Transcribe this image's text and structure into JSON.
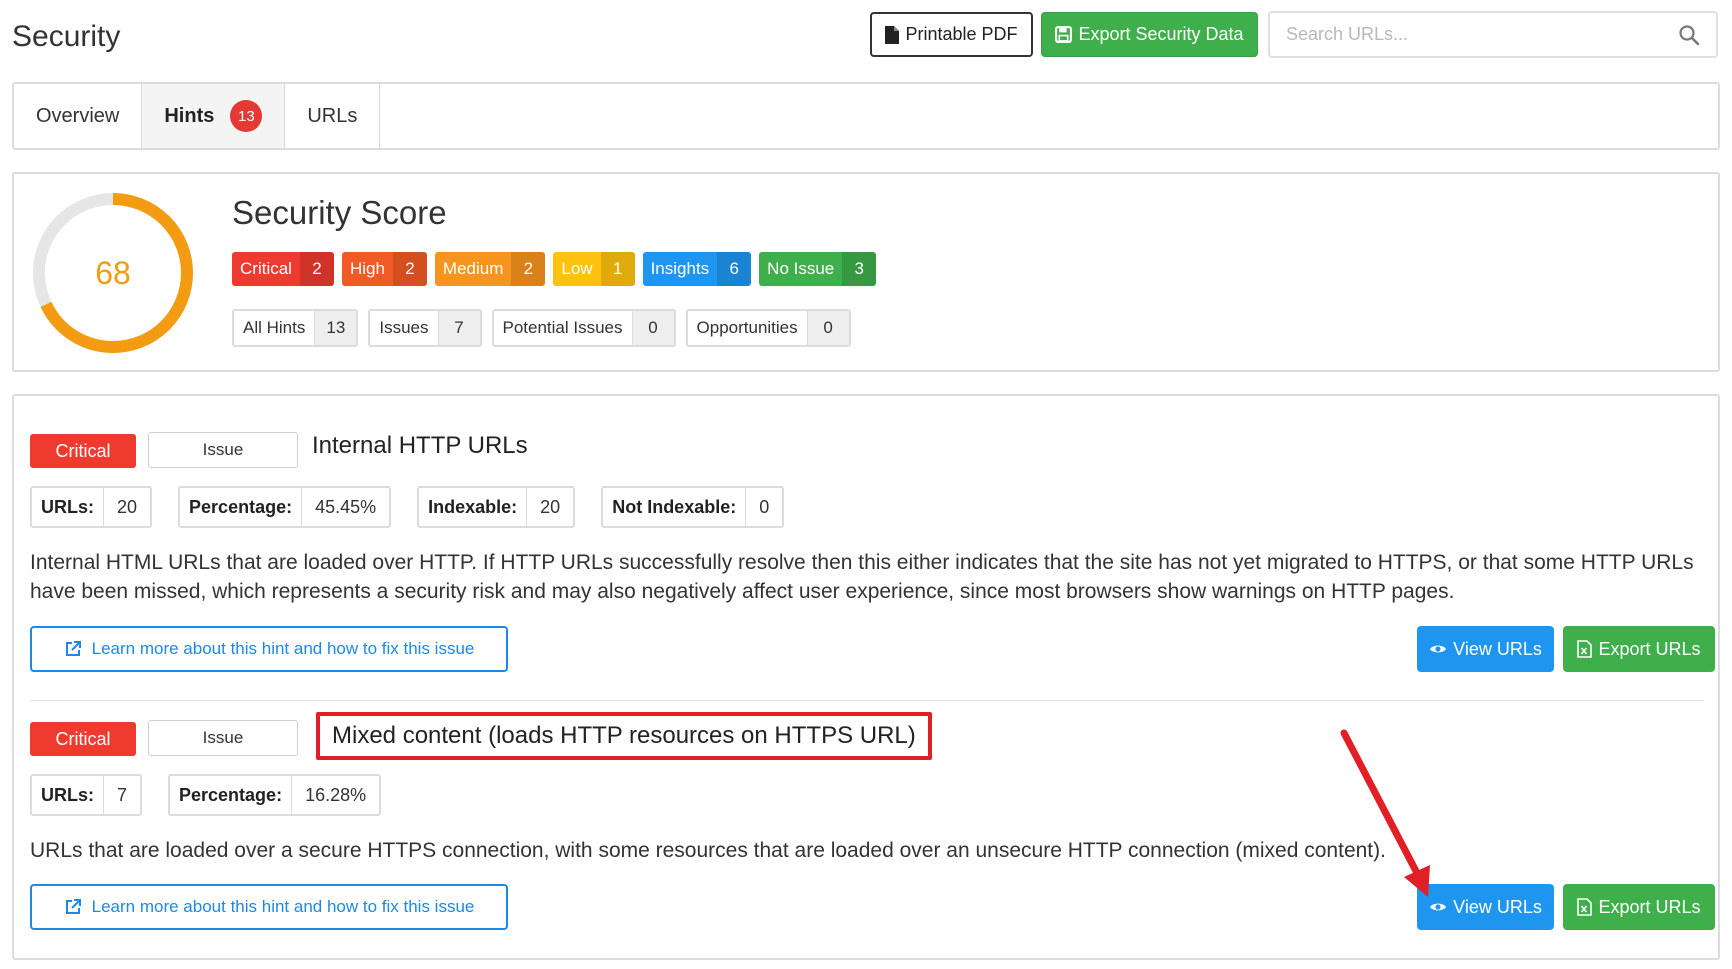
{
  "header": {
    "title": "Security",
    "printable_pdf_label": "Printable PDF",
    "export_data_label": "Export Security Data",
    "search_placeholder": "Search URLs..."
  },
  "tabs": [
    {
      "label": "Overview",
      "active": false
    },
    {
      "label": "Hints",
      "active": true,
      "badge": "13"
    },
    {
      "label": "URLs",
      "active": false
    }
  ],
  "score": {
    "value": "68",
    "fraction": 0.68,
    "heading": "Security Score",
    "color": "#f39c12",
    "track_color": "#e6e6e6"
  },
  "severities": [
    {
      "label": "Critical",
      "count": "2",
      "color": "#ef3b2f"
    },
    {
      "label": "High",
      "count": "2",
      "color": "#f15a24"
    },
    {
      "label": "Medium",
      "count": "2",
      "color": "#f7941d"
    },
    {
      "label": "Low",
      "count": "1",
      "color": "#ffc20e"
    },
    {
      "label": "Insights",
      "count": "6",
      "color": "#1e96f0"
    },
    {
      "label": "No Issue",
      "count": "3",
      "color": "#3eaf4a"
    }
  ],
  "hint_types": [
    {
      "label": "All Hints",
      "count": "13"
    },
    {
      "label": "Issues",
      "count": "7"
    },
    {
      "label": "Potential Issues",
      "count": "0"
    },
    {
      "label": "Opportunities",
      "count": "0"
    }
  ],
  "hints": [
    {
      "severity": "Critical",
      "type": "Issue",
      "title": "Internal HTTP URLs",
      "stats": [
        {
          "key": "URLs:",
          "value": "20"
        },
        {
          "key": "Percentage:",
          "value": "45.45%"
        },
        {
          "key": "Indexable:",
          "value": "20"
        },
        {
          "key": "Not Indexable:",
          "value": "0"
        }
      ],
      "description": "Internal HTML URLs that are loaded over HTTP. If HTTP URLs successfully resolve then this either indicates that the site has not yet migrated to HTTPS, or that some HTTP URLs have been missed, which represents a security risk and may also negatively affect user experience, since most browsers show warnings on HTTP pages.",
      "learn_more": "Learn more about this hint and how to fix this issue",
      "view_label": "View URLs",
      "export_label": "Export URLs"
    },
    {
      "severity": "Critical",
      "type": "Issue",
      "title": "Mixed content (loads HTTP resources on HTTPS URL)",
      "stats": [
        {
          "key": "URLs:",
          "value": "7"
        },
        {
          "key": "Percentage:",
          "value": "16.28%"
        }
      ],
      "description": "URLs that are loaded over a secure HTTPS connection, with some resources that are loaded over an unsecure HTTP connection (mixed content).",
      "learn_more": "Learn more about this hint and how to fix this issue",
      "view_label": "View URLs",
      "export_label": "Export URLs"
    }
  ],
  "annotation": {
    "highlight_color": "#e01f26"
  }
}
